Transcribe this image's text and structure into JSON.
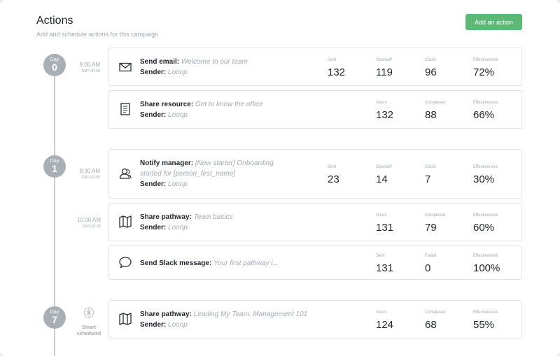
{
  "header": {
    "title": "Actions",
    "subtitle": "Add and schedule actions for this campaign",
    "add_button": "Add an action"
  },
  "days": [
    {
      "label": "Day",
      "number": "0"
    },
    {
      "label": "Day",
      "number": "1"
    },
    {
      "label": "Day",
      "number": "7"
    }
  ],
  "times": [
    {
      "time": "9:00 AM",
      "tz": "GMT+01:00"
    },
    {
      "time": "9:30 AM",
      "tz": "GMT+01:00"
    },
    {
      "time": "10:00 AM",
      "tz": "GMT+01:00"
    }
  ],
  "smart": {
    "line1": "Smart",
    "line2": "scheduled"
  },
  "actions": [
    {
      "icon": "envelope-icon",
      "type": "Send email:",
      "name": "Welcome to our team",
      "sender_label": "Sender:",
      "sender": "Looop",
      "stats": [
        {
          "label": "Sent",
          "value": "132"
        },
        {
          "label": "Opened*",
          "value": "119"
        },
        {
          "label": "Clicks",
          "value": "96"
        },
        {
          "label": "Effectiveness",
          "value": "72%"
        }
      ]
    },
    {
      "icon": "document-icon",
      "type": "Share resource:",
      "name": "Get to know the office",
      "sender_label": "Sender:",
      "sender": "Looop",
      "stats": [
        {
          "label": "Users",
          "value": "132"
        },
        {
          "label": "Completed",
          "value": "88"
        },
        {
          "label": "Effectiveness",
          "value": "66%"
        }
      ]
    },
    {
      "icon": "users-icon",
      "type": "Notify manager:",
      "name_line1": "[New starter] Onboarding",
      "name_line2": "started for [person_first_name]",
      "sender_label": "Sender:",
      "sender": "Looop",
      "stats": [
        {
          "label": "Sent",
          "value": "23"
        },
        {
          "label": "Opened*",
          "value": "14"
        },
        {
          "label": "Clicks",
          "value": "7"
        },
        {
          "label": "Effectiveness",
          "value": "30%"
        }
      ]
    },
    {
      "icon": "map-icon",
      "type": "Share pathway:",
      "name": "Team basics",
      "sender_label": "Sender:",
      "sender": "Looop",
      "stats": [
        {
          "label": "Users",
          "value": "131"
        },
        {
          "label": "Completed",
          "value": "79"
        },
        {
          "label": "Effectiveness",
          "value": "60%"
        }
      ]
    },
    {
      "icon": "chat-bubble-icon",
      "type": "Send Slack message:",
      "name": "Your first pathway i...",
      "stats": [
        {
          "label": "Sent",
          "value": "131"
        },
        {
          "label": "Failed",
          "value": "0"
        },
        {
          "label": "Effectiveness",
          "value": "100%"
        }
      ]
    },
    {
      "icon": "map-icon",
      "type": "Share pathway:",
      "name": "Leading My Team: Management 101",
      "sender_label": "Sender:",
      "sender": "Looop",
      "stats": [
        {
          "label": "Users",
          "value": "124"
        },
        {
          "label": "Completed",
          "value": "68"
        },
        {
          "label": "Effectiveness",
          "value": "55%"
        }
      ]
    }
  ]
}
